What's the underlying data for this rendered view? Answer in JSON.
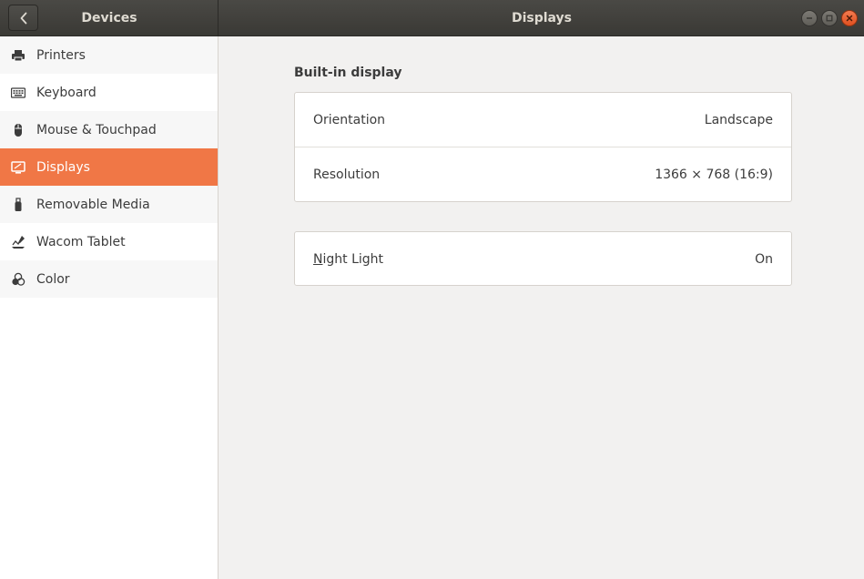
{
  "header": {
    "left_title": "Devices",
    "right_title": "Displays"
  },
  "sidebar": {
    "items": [
      {
        "label": "Printers",
        "icon": "printer-icon"
      },
      {
        "label": "Keyboard",
        "icon": "keyboard-icon"
      },
      {
        "label": "Mouse & Touchpad",
        "icon": "mouse-icon"
      },
      {
        "label": "Displays",
        "icon": "display-icon",
        "active": true
      },
      {
        "label": "Removable Media",
        "icon": "usb-drive-icon"
      },
      {
        "label": "Wacom Tablet",
        "icon": "tablet-icon"
      },
      {
        "label": "Color",
        "icon": "color-icon"
      }
    ]
  },
  "main": {
    "section_title": "Built-in display",
    "display": {
      "orientation_label": "Orientation",
      "orientation_value": "Landscape",
      "resolution_label": "Resolution",
      "resolution_value": "1366 × 768 (16:9)"
    },
    "night_light": {
      "label_first": "N",
      "label_rest": "ight Light",
      "value": "On"
    }
  },
  "colors": {
    "accent": "#f07746",
    "headerbar": "#3d3c38",
    "close_button": "#e9592a"
  }
}
